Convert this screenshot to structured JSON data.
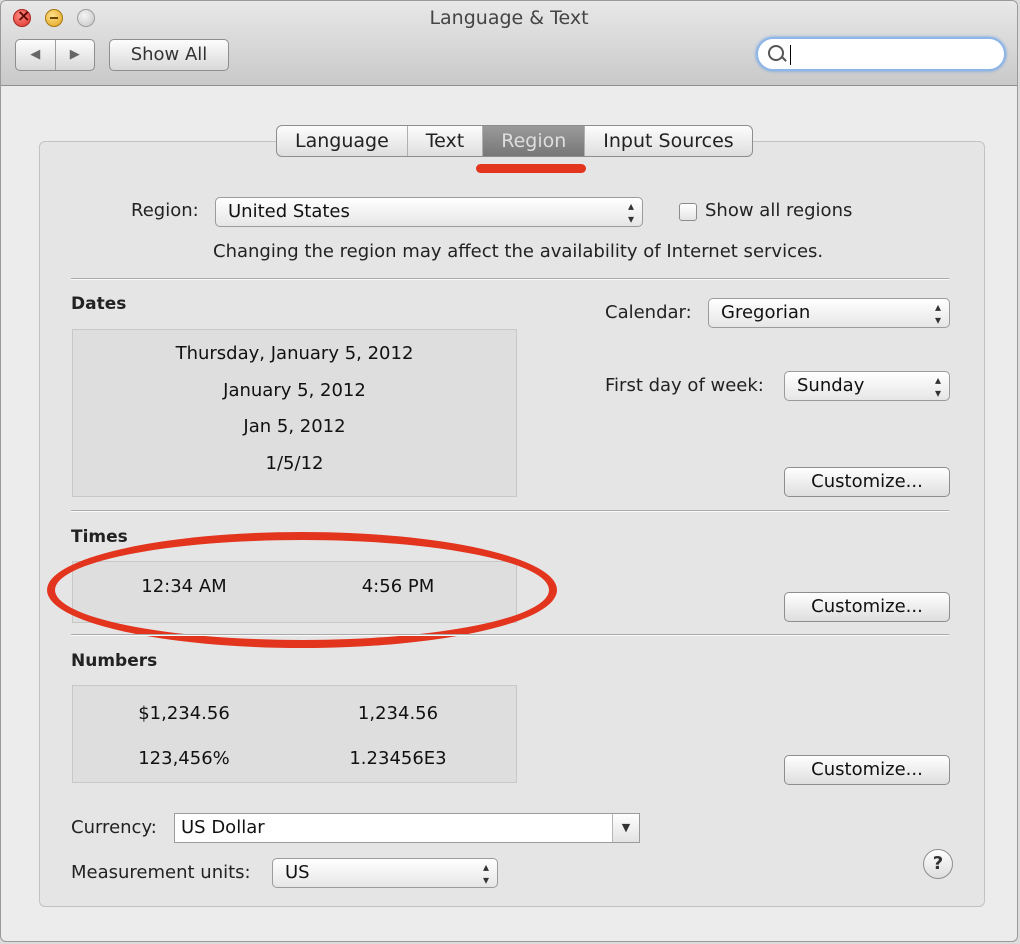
{
  "window": {
    "title": "Language & Text"
  },
  "toolbar": {
    "back_icon": "◀",
    "forward_icon": "▶",
    "show_all_label": "Show All",
    "search_value": ""
  },
  "tabs": [
    {
      "label": "Language",
      "active": false
    },
    {
      "label": "Text",
      "active": false
    },
    {
      "label": "Region",
      "active": true
    },
    {
      "label": "Input Sources",
      "active": false
    }
  ],
  "region": {
    "label": "Region:",
    "value": "United States",
    "show_all_label": "Show all regions",
    "show_all_checked": false,
    "note": "Changing the region may affect the availability of Internet services."
  },
  "dates": {
    "heading": "Dates",
    "samples": [
      "Thursday, January 5, 2012",
      "January 5, 2012",
      "Jan 5, 2012",
      "1/5/12"
    ],
    "calendar_label": "Calendar:",
    "calendar_value": "Gregorian",
    "first_day_label": "First day of week:",
    "first_day_value": "Sunday",
    "customize_label": "Customize..."
  },
  "times": {
    "heading": "Times",
    "samples": [
      "12:34 AM",
      "4:56 PM"
    ],
    "customize_label": "Customize..."
  },
  "numbers": {
    "heading": "Numbers",
    "samples": [
      "$1,234.56",
      "1,234.56",
      "123,456%",
      "1.23456E3"
    ],
    "customize_label": "Customize..."
  },
  "currency": {
    "label": "Currency:",
    "value": "US Dollar"
  },
  "measurement": {
    "label": "Measurement units:",
    "value": "US"
  },
  "help_label": "?",
  "annotation_color": "#e3341e"
}
